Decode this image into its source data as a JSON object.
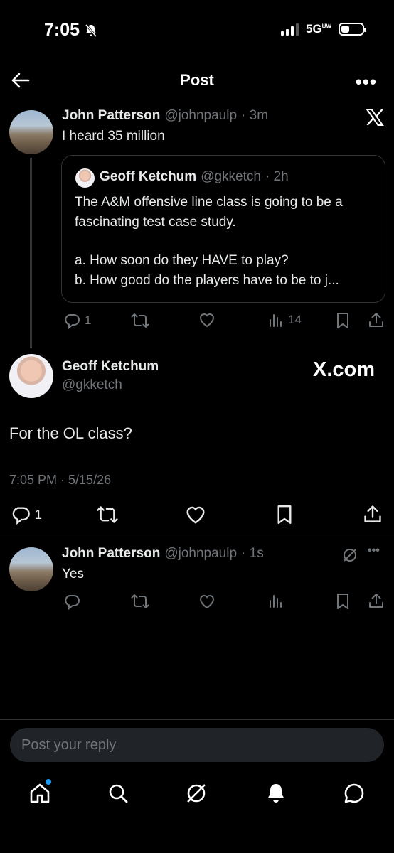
{
  "status_bar": {
    "time": "7:05",
    "network": "5G",
    "network_sup": "UW"
  },
  "header": {
    "title": "Post"
  },
  "reply_parent": {
    "name": "John Patterson",
    "handle": "@johnpaulp",
    "time": "· 3m",
    "text": "I heard 35 million",
    "quoted": {
      "name": "Geoff Ketchum",
      "handle": "@gkketch",
      "time": "· 2h",
      "line1": "The A&M offensive line class is going to be a",
      "line2": "fascinating test case study.",
      "line3": "a. How soon do they HAVE to play?",
      "line4": "b. How good do the players have to be to j..."
    },
    "metrics": {
      "replies": "1",
      "views": "14"
    }
  },
  "main_post": {
    "name": "Geoff Ketchum",
    "handle": "@gkketch",
    "watermark": "X.com",
    "text": "For the OL class?",
    "timestamp": "7:05 PM · 5/15/26",
    "metrics": {
      "replies": "1"
    }
  },
  "reply": {
    "name": "John Patterson",
    "handle": "@johnpaulp",
    "time": "· 1s",
    "text": "Yes"
  },
  "composer": {
    "placeholder": "Post your reply"
  },
  "icons": {
    "back": "arrow-left-icon",
    "more": "more-icon",
    "x_logo": "x-logo-icon",
    "reply": "reply-icon",
    "repost": "repost-icon",
    "like": "like-icon",
    "views": "views-icon",
    "bookmark": "bookmark-icon",
    "share": "share-icon",
    "grok": "grok-icon",
    "home": "home-icon",
    "search": "search-icon",
    "notifications": "bell-icon",
    "messages": "message-icon"
  },
  "colors": {
    "background": "#000000",
    "text": "#e7e9ea",
    "muted": "#71767b",
    "accent": "#1d9bf0"
  }
}
